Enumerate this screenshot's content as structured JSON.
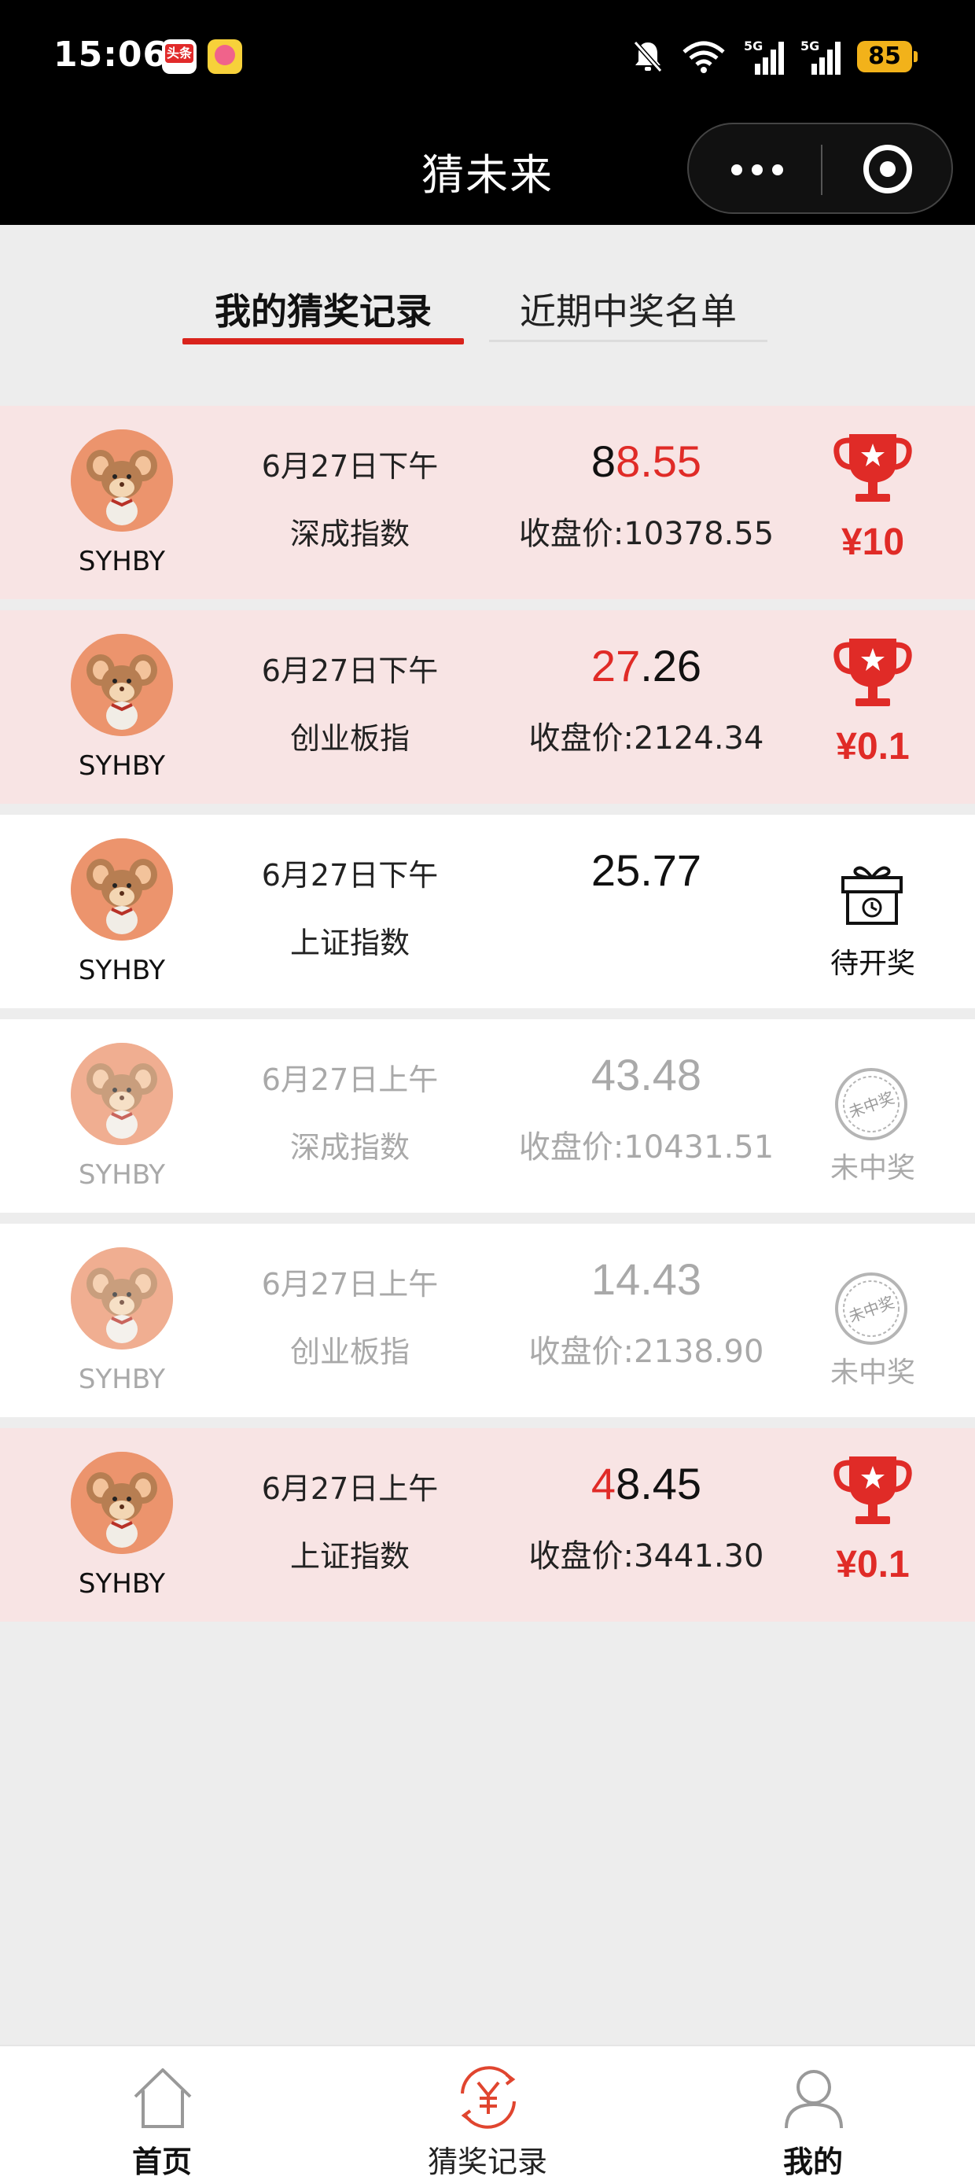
{
  "status_bar": {
    "time": "15:06",
    "app_icon_1": "头条",
    "battery": "85",
    "network": [
      "5G",
      "5G"
    ]
  },
  "header": {
    "title": "猜未来",
    "more_icon": "more-dots-icon",
    "close_icon": "target-close-icon"
  },
  "tabs": [
    {
      "label": "我的猜奖记录",
      "active": true
    },
    {
      "label": "近期中奖名单",
      "active": false
    }
  ],
  "records": [
    {
      "username": "SYHBY",
      "date": "6月27日下午",
      "index": "深成指数",
      "guess_prefix": "8",
      "guess_highlight": "8.55",
      "guess_suffix": "",
      "close": "收盘价:10378.55",
      "status": "won",
      "prize": "¥10"
    },
    {
      "username": "SYHBY",
      "date": "6月27日下午",
      "index": "创业板指",
      "guess_prefix": "",
      "guess_highlight": "27",
      "guess_suffix": ".26",
      "close": "收盘价:2124.34",
      "status": "won",
      "prize": "¥0.1"
    },
    {
      "username": "SYHBY",
      "date": "6月27日下午",
      "index": "上证指数",
      "guess_prefix": "25.77",
      "guess_highlight": "",
      "guess_suffix": "",
      "close": "",
      "status": "pending",
      "status_text": "待开奖"
    },
    {
      "username": "SYHBY",
      "date": "6月27日上午",
      "index": "深成指数",
      "guess_prefix": "43.48",
      "guess_highlight": "",
      "guess_suffix": "",
      "close": "收盘价:10431.51",
      "status": "lost",
      "status_text": "未中奖",
      "stamp_text": "未中奖"
    },
    {
      "username": "SYHBY",
      "date": "6月27日上午",
      "index": "创业板指",
      "guess_prefix": "14.43",
      "guess_highlight": "",
      "guess_suffix": "",
      "close": "收盘价:2138.90",
      "status": "lost",
      "status_text": "未中奖",
      "stamp_text": "未中奖"
    },
    {
      "username": "SYHBY",
      "date": "6月27日上午",
      "index": "上证指数",
      "guess_prefix": "",
      "guess_highlight": "4",
      "guess_suffix": "8.45",
      "close": "收盘价:3441.30",
      "status": "won",
      "prize": "¥0.1"
    }
  ],
  "bottom_nav": [
    {
      "label": "首页",
      "icon": "home-icon",
      "active": false
    },
    {
      "label": "猜奖记录",
      "icon": "yuan-cycle-icon",
      "active": true
    },
    {
      "label": "我的",
      "icon": "user-icon",
      "active": false
    }
  ],
  "colors": {
    "accent": "#e02b27",
    "won_row_bg": "#f8e4e4",
    "header_bg": "#000000",
    "page_bg": "#ededed"
  }
}
